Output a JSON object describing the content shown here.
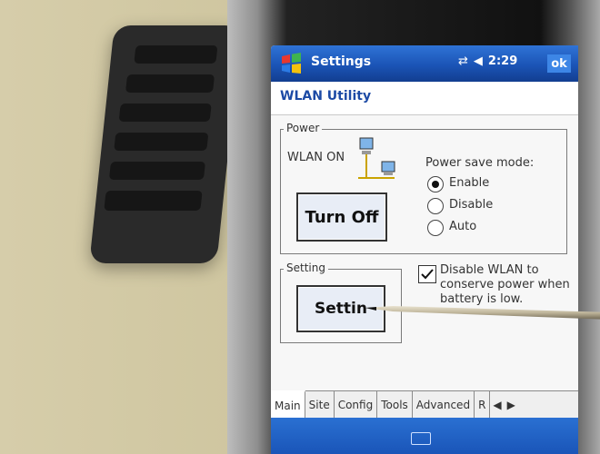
{
  "titlebar": {
    "app_title": "Settings",
    "time": "2:29",
    "ok_label": "ok"
  },
  "subtitle": "WLAN Utility",
  "power": {
    "group_label": "Power",
    "wlan_status": "WLAN ON",
    "toggle_label": "Turn Off",
    "save_mode_label": "Power save mode:",
    "options": [
      "Enable",
      "Disable",
      "Auto"
    ],
    "selected": "Enable"
  },
  "setting": {
    "group_label": "Setting",
    "button_label": "Settin",
    "checkbox_label": "Disable WLAN to conserve power when battery is low.",
    "checkbox_checked": true
  },
  "tabs": [
    "Main",
    "Site",
    "Config",
    "Tools",
    "Advanced",
    "R"
  ],
  "active_tab": "Main",
  "colors": {
    "titlebar": "#1b54b6",
    "subtitle_text": "#1c4aa5",
    "screen_bg": "#f7f7f7"
  },
  "icons": [
    "windows-logo-icon",
    "connectivity-icon",
    "volume-icon",
    "network-computer-icon",
    "checkmark-icon",
    "arrow-left-icon",
    "arrow-right-icon",
    "keyboard-icon"
  ]
}
